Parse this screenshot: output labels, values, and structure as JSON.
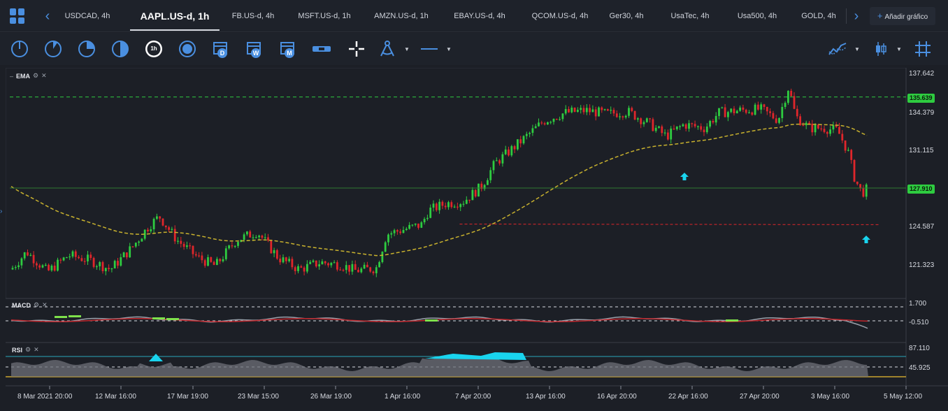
{
  "tabs": {
    "prev_icon": "chevron-left-icon",
    "next_icon": "chevron-right-icon",
    "items": [
      {
        "label": "USDCAD, 4h"
      },
      {
        "label": "AAPL.US-d, 1h",
        "active": true
      },
      {
        "label": "FB.US-d, 4h"
      },
      {
        "label": "MSFT.US-d, 1h"
      },
      {
        "label": "AMZN.US-d, 1h"
      },
      {
        "label": "EBAY.US-d, 4h"
      },
      {
        "label": "QCOM.US-d, 4h"
      },
      {
        "label": "Ger30, 4h"
      },
      {
        "label": "UsaTec, 4h"
      },
      {
        "label": "Usa500, 4h"
      },
      {
        "label": "GOLD, 4h"
      }
    ],
    "add_chart_label": "Añadir gráfico",
    "add_chart_icon": "+"
  },
  "toolbar": {
    "timeframe_icons": [
      "clock-1m-icon",
      "clock-5m-icon",
      "clock-15m-icon",
      "clock-30m-icon",
      "clock-1h-icon",
      "clock-4h-icon"
    ],
    "active_timeframe_label": "1h",
    "period_labels": [
      "D",
      "W",
      "M"
    ],
    "drawing_icons": [
      "horizontal-range-icon",
      "crosshair-icon",
      "drawing-tools-icon",
      "line-style-icon"
    ],
    "right_icons": [
      "indicators-icon",
      "chart-type-icon",
      "grid-icon"
    ]
  },
  "chart": {
    "price_levels": [
      "137.642",
      "134.379",
      "131.115",
      "127.910",
      "124.587",
      "121.323"
    ],
    "green_line_price": "135.639",
    "current_price": "127.910",
    "macd_levels": [
      "1.700",
      "-0.510"
    ],
    "rsi_levels": [
      "87.110",
      "45.925"
    ],
    "time_labels": [
      "8 Mar 2021 20:00",
      "12 Mar 16:00",
      "17 Mar 19:00",
      "23 Mar 15:00",
      "26 Mar 19:00",
      "1 Apr 16:00",
      "7 Apr 20:00",
      "13 Apr 16:00",
      "16 Apr 20:00",
      "22 Apr 16:00",
      "27 Apr 20:00",
      "3 May 16:00",
      "5 May 12:00"
    ],
    "panels": {
      "main": {
        "label": "EMA"
      },
      "macd": {
        "label": "MACD"
      },
      "rsi": {
        "label": "RSI"
      }
    },
    "colors": {
      "up": "#2ecc40",
      "down": "#e0262b",
      "ema": "#c9b22e",
      "support": "#2ecc40",
      "resistance": "#e0262b",
      "accent": "#4a8fe0",
      "signal_arrow": "#19d4ee"
    }
  }
}
